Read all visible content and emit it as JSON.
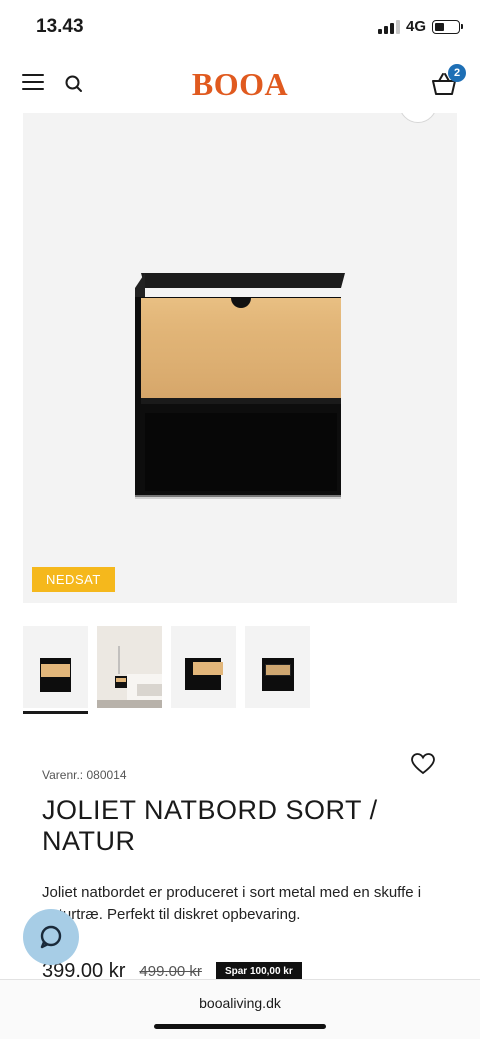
{
  "status_bar": {
    "time": "13.43",
    "network": "4G",
    "battery_level": 0.4
  },
  "header": {
    "logo": "BOOA",
    "cart_count": "2"
  },
  "product": {
    "sale_badge": "NEDSAT",
    "sku": "Varenr.: 080014",
    "title": "JOLIET NATBORD SORT / NATUR",
    "description": "Joliet natbordet er produceret i sort metal med en skuffe i naturtræ. Perfekt til diskret opbevaring.",
    "price": "399.00 kr",
    "old_price": "499.00 kr",
    "savings": "Spar 100,00 kr"
  },
  "thumbnails": [
    "front-view",
    "bedroom-view",
    "open-drawer-view",
    "angled-view"
  ],
  "browser": {
    "url": "booaliving.dk"
  },
  "colors": {
    "brand": "#e05a1f",
    "sale": "#f5b81c",
    "badge": "#1e6fb5",
    "chat": "#a7cde6"
  }
}
